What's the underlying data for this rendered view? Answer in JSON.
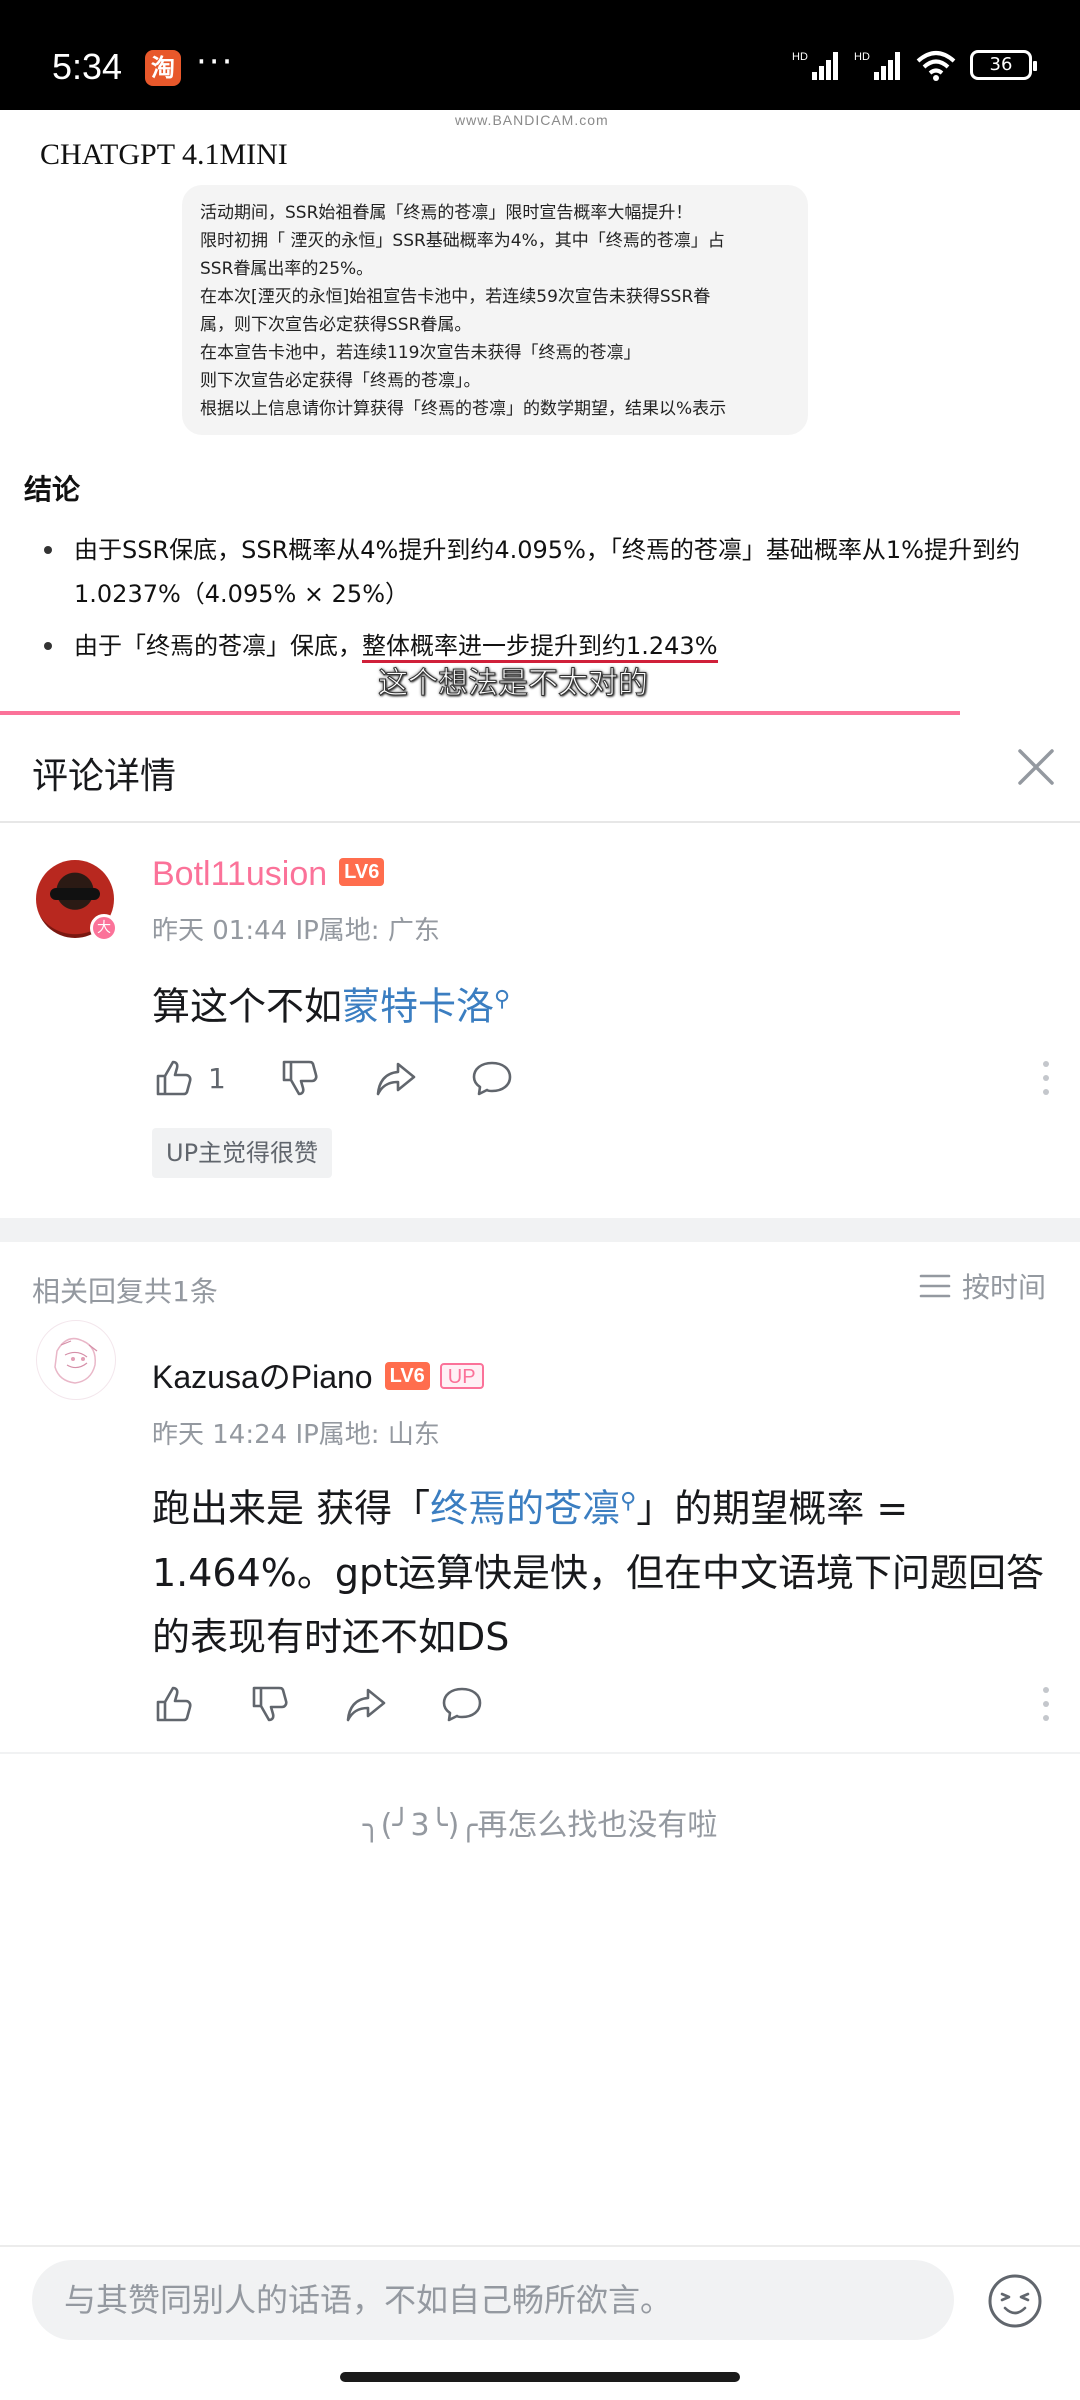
{
  "status_bar": {
    "time": "5:34",
    "app_icon_char": "淘",
    "more": "···",
    "signal1": "HD",
    "signal2": "HD",
    "battery": "36"
  },
  "video": {
    "watermark": "www.BANDICAM.com",
    "model_title": "CHATGPT 4.1MINI",
    "prompt_lines": [
      "活动期间，SSR始祖眷属「终焉的苍凛」限时宣告概率大幅提升！",
      "限时初拥「 湮灭的永恒」SSR基础概率为4%，其中「终焉的苍凛」占",
      "SSR眷属出率的25%。",
      "在本次[湮灭的永恒]始祖宣告卡池中，若连续59次宣告未获得SSR眷",
      "属，则下次宣告必定获得SSR眷属。",
      "在本宣告卡池中，若连续119次宣告未获得「终焉的苍凛」",
      "则下次宣告必定获得「终焉的苍凛」。",
      "根据以上信息请你计算获得「终焉的苍凛」的数学期望，结果以%表示"
    ],
    "conclusion_heading": "结论",
    "bullet1_line1": "由于SSR保底，SSR概率从4%提升到约4.095%，「终焉的苍凛」基础概率从1%提升到约",
    "bullet1_line2": "1.0237%（4.095% × 25%）",
    "bullet2_prefix": "由于「终焉的苍凛」保底，",
    "bullet2_highlight": "整体概率进一步提升到约1.243%",
    "subtitle": "这个想法是不太对的",
    "progress_color": "#fb7299"
  },
  "panel": {
    "title": "评论详情"
  },
  "main_comment": {
    "avatar_badge": "大",
    "username": "Botl11usion",
    "level": "LV6",
    "meta": "昨天 01:44 IP属地: 广东",
    "text_prefix": "算这个不如",
    "text_link": "蒙特卡洛",
    "like_count": "1",
    "up_liked": "UP主觉得很赞"
  },
  "replies": {
    "header": "相关回复共1条",
    "sort_label": "按时间",
    "items": [
      {
        "username": "KazusaのPiano",
        "level": "LV6",
        "up_tag": "UP",
        "meta": "昨天 14:24 IP属地: 山东",
        "line1_prefix": "跑出来是 获得「",
        "line1_link": "终焉的苍凛",
        "line1_suffix": "」的期望概率 =",
        "line2": "1.464%。gpt运算快是快，但在中文语境下问题回答",
        "line3": "的表现有时还不如DS"
      }
    ]
  },
  "end_message": "╮(╯3╰)╭再怎么找也没有啦",
  "input": {
    "placeholder": "与其赞同别人的话语，不如自己畅所欲言。"
  },
  "colors": {
    "accent_pink": "#fb7299",
    "link_blue": "#3b7ec1",
    "level_orange": "#ff6d4d"
  }
}
